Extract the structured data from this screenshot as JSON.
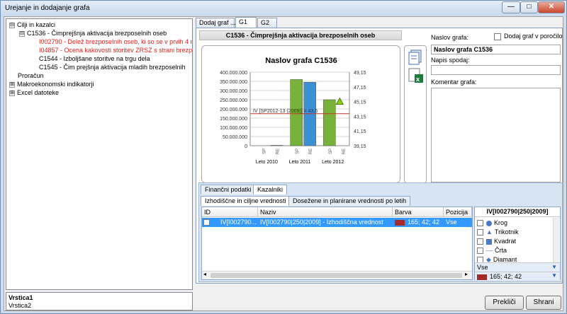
{
  "window": {
    "title": "Urejanje in dodajanje grafa",
    "min": "—",
    "max": "□",
    "close": "✕"
  },
  "tree": {
    "items": [
      {
        "label": "Cilji in kazalci",
        "toggle": "⊟",
        "red": false
      },
      {
        "label": "C1536 - Čimprejšnja aktivacija brezposelnih oseb",
        "toggle": "⊟",
        "red": false
      },
      {
        "label": "I002790 - Delež brezposelnih oseb, ki so se v prvih 4 m",
        "toggle": "",
        "red": true
      },
      {
        "label": "I04857 - Ocena kakovosti storitev ZRSZ s strani brezpo",
        "toggle": "",
        "red": true
      },
      {
        "label": "C1544 - Izboljšane storitve na trgu dela",
        "toggle": "",
        "red": false
      },
      {
        "label": "C1545 - Čim prejšnja aktivacija mladih brezposelnih",
        "toggle": "",
        "red": false
      },
      {
        "label": "Proračun",
        "toggle": "",
        "red": false
      },
      {
        "label": "Makroekonomski indikatorji",
        "toggle": "⊞",
        "red": false
      },
      {
        "label": "Excel datoteke",
        "toggle": "⊞",
        "red": false
      }
    ]
  },
  "status": {
    "line1": "Vrstica1",
    "line2": "Vrstica2"
  },
  "tabs": [
    "Dodaj graf ...",
    "G1",
    "G2"
  ],
  "card_title": "C1536 - Čimprejšnja aktivacija brezposelnih oseb",
  "chart_data": {
    "type": "bar",
    "title": "Naslov grafa C1536",
    "categories": [
      "Leto 2010",
      "Leto 2011",
      "Leto 2012"
    ],
    "bar_labels": [
      "SP",
      "RE"
    ],
    "series": [
      {
        "name": "SP",
        "values": [
          0,
          360000000,
          250000000
        ],
        "color": "#79b23a"
      },
      {
        "name": "RE",
        "values": [
          2000000,
          345000000,
          0
        ],
        "color": "#3d8fd6"
      }
    ],
    "ylim": [
      0,
      400000000
    ],
    "y_ticks": [
      "400.000.000",
      "350.000.000",
      "300.000.000",
      "250.000.000",
      "200.000.000",
      "150.000.000",
      "100.000.000",
      "50.000.000",
      "0"
    ],
    "y2lim": [
      39.15,
      49.15
    ],
    "y2_ticks": [
      "49,15",
      "47,15",
      "45,15",
      "43,15",
      "41,15",
      "39,15"
    ],
    "reference_line": {
      "label": "IV [SP2012-13 (2009)] = 43,5",
      "value": 43.5,
      "color": "#c0392b"
    },
    "marker": {
      "category": "Leto 2012",
      "value": 45.15,
      "color": "#88d000"
    },
    "grid": true
  },
  "form": {
    "naslov_label": "Naslov grafa:",
    "naslov_value": "Naslov grafa C1536",
    "porocilo_label": "Dodaj graf v poročilo",
    "napis_label": "Napis spodaj:",
    "napis_value": "",
    "komentar_label": "Komentar grafa:",
    "komentar_value": ""
  },
  "lower": {
    "tabs": [
      "Finančni podatki",
      "Kazalniki"
    ],
    "subtabs": [
      "Izhodiščne in ciljne vrednosti",
      "Dosežene in planirane vrednosti po letih"
    ],
    "columns": [
      "ID",
      "Naziv",
      "Barva",
      "Pozicija"
    ],
    "row": {
      "id": "IV[I002790...",
      "naziv": "IV[I002790|250|2009] - Izhodiščna vrednost",
      "barva": "165; 42; 42",
      "barva_color": "#a52a2a",
      "pozicija": "Vse"
    }
  },
  "marker_panel": {
    "title": "IV[I002790|250|2009]",
    "items": [
      {
        "label": "Krog",
        "icon": "circle-icon"
      },
      {
        "label": "Trikotnik",
        "icon": "triangle-icon"
      },
      {
        "label": "Kvadrat",
        "icon": "square-icon"
      },
      {
        "label": "Črta",
        "icon": "line-icon"
      },
      {
        "label": "Diamant",
        "icon": "diamond-icon"
      }
    ],
    "position": "Vse",
    "color": "165; 42; 42",
    "color_hex": "#a52a2a"
  },
  "buttons": {
    "cancel": "Prekliči",
    "save": "Shrani"
  }
}
